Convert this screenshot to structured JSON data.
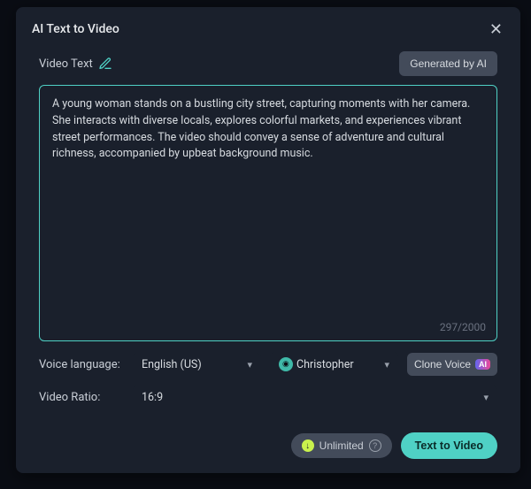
{
  "modal": {
    "title": "AI Text to Video",
    "video_text_label": "Video Text",
    "generated_by_ai_label": "Generated by AI",
    "prompt_value": "A young woman stands on a bustling city street, capturing moments with her camera. She interacts with diverse locals, explores colorful markets, and experiences vibrant street performances. The video should convey a sense of adventure and cultural richness, accompanied by upbeat background music.",
    "char_count": "297/2000",
    "voice_language_label": "Voice language:",
    "voice_language_value": "English (US)",
    "voice_name": "Christopher",
    "clone_voice_label": "Clone Voice",
    "ai_badge": "AI",
    "video_ratio_label": "Video Ratio:",
    "video_ratio_value": "16:9",
    "unlimited_label": "Unlimited",
    "text_to_video_label": "Text to Video"
  }
}
